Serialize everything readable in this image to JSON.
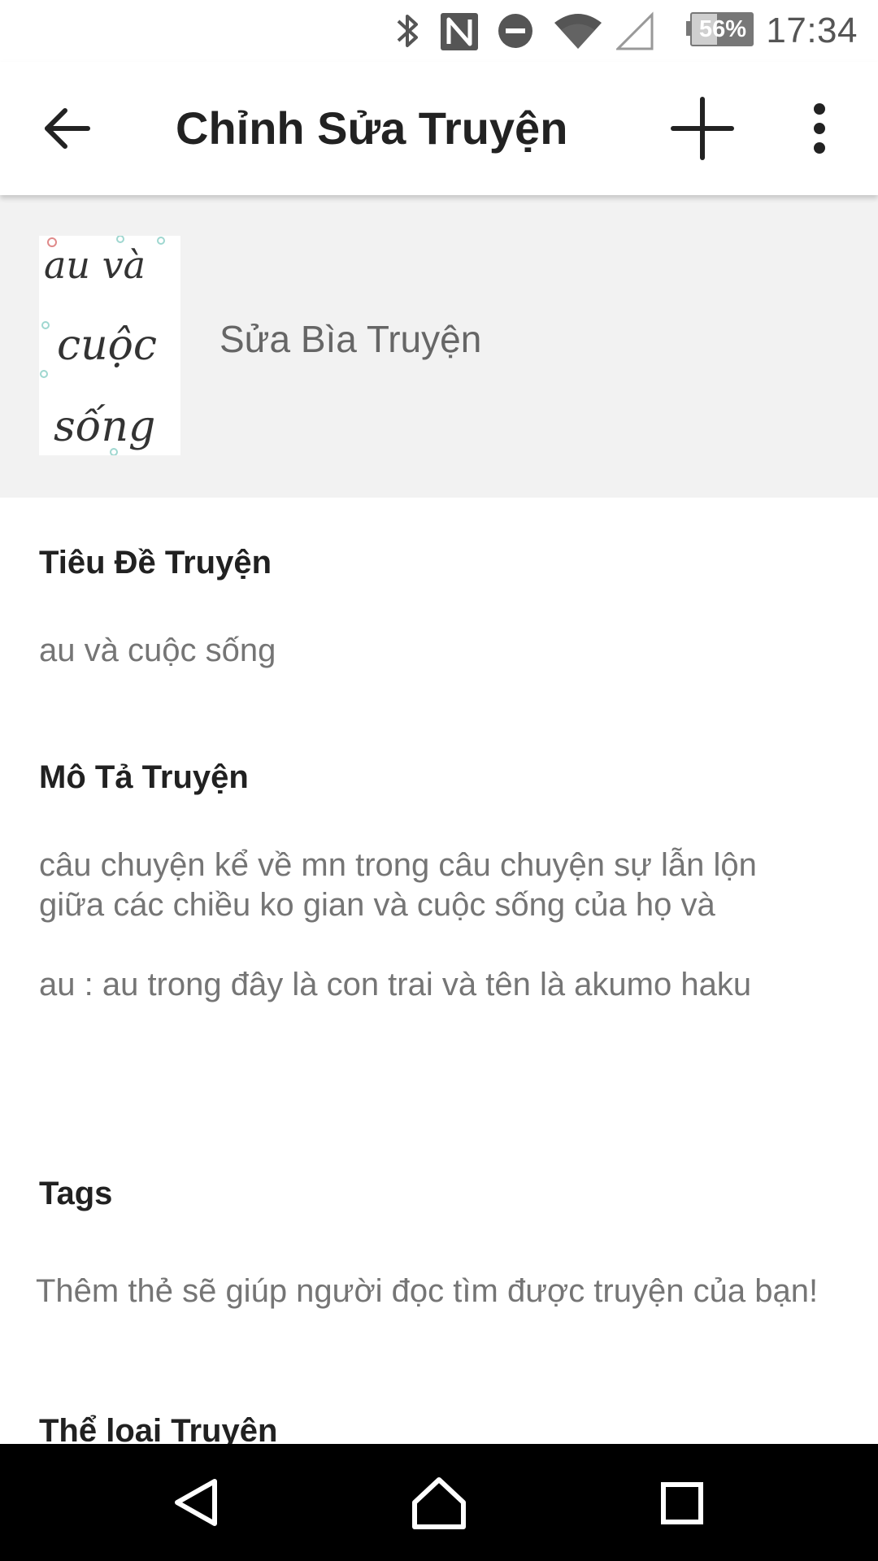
{
  "status_bar": {
    "time": "17:34",
    "battery_percent": "56%",
    "icons": [
      "bluetooth-icon",
      "nfc-icon",
      "do-not-disturb-icon",
      "wifi-icon",
      "cellular-signal-icon",
      "battery-icon"
    ]
  },
  "app_bar": {
    "title": "Chỉnh Sửa Truyện",
    "back_icon": "arrow-back-icon",
    "add_icon": "plus-icon",
    "menu_icon": "more-vertical-icon"
  },
  "cover": {
    "edit_label": "Sửa Bìa Truyện",
    "thumbnail_text": [
      "au và",
      "cuộc",
      "sống"
    ]
  },
  "form": {
    "title_label": "Tiêu Đề Truyện",
    "title_value": "au và cuộc sống",
    "description_label": "Mô Tả Truyện",
    "description_lines": [
      "câu chuyện kể về mn trong câu chuyện sự lẫn lộn",
      "giữa các chiều ko gian và cuộc sống của họ và",
      "",
      "au : au trong đây là con trai  và tên là akumo haku"
    ],
    "tags_label": "Tags",
    "tags_placeholder": "Thêm thẻ sẽ giúp người đọc tìm được truyện của bạn!",
    "genre_label": "Thể loại Truyện"
  },
  "nav_bar": {
    "back_icon": "nav-back-icon",
    "home_icon": "nav-home-icon",
    "recents_icon": "nav-recents-icon"
  },
  "colors": {
    "cover_background": "#f2f2f2",
    "label_text": "#212121",
    "value_text": "#757575",
    "nav_bar": "#000000"
  }
}
